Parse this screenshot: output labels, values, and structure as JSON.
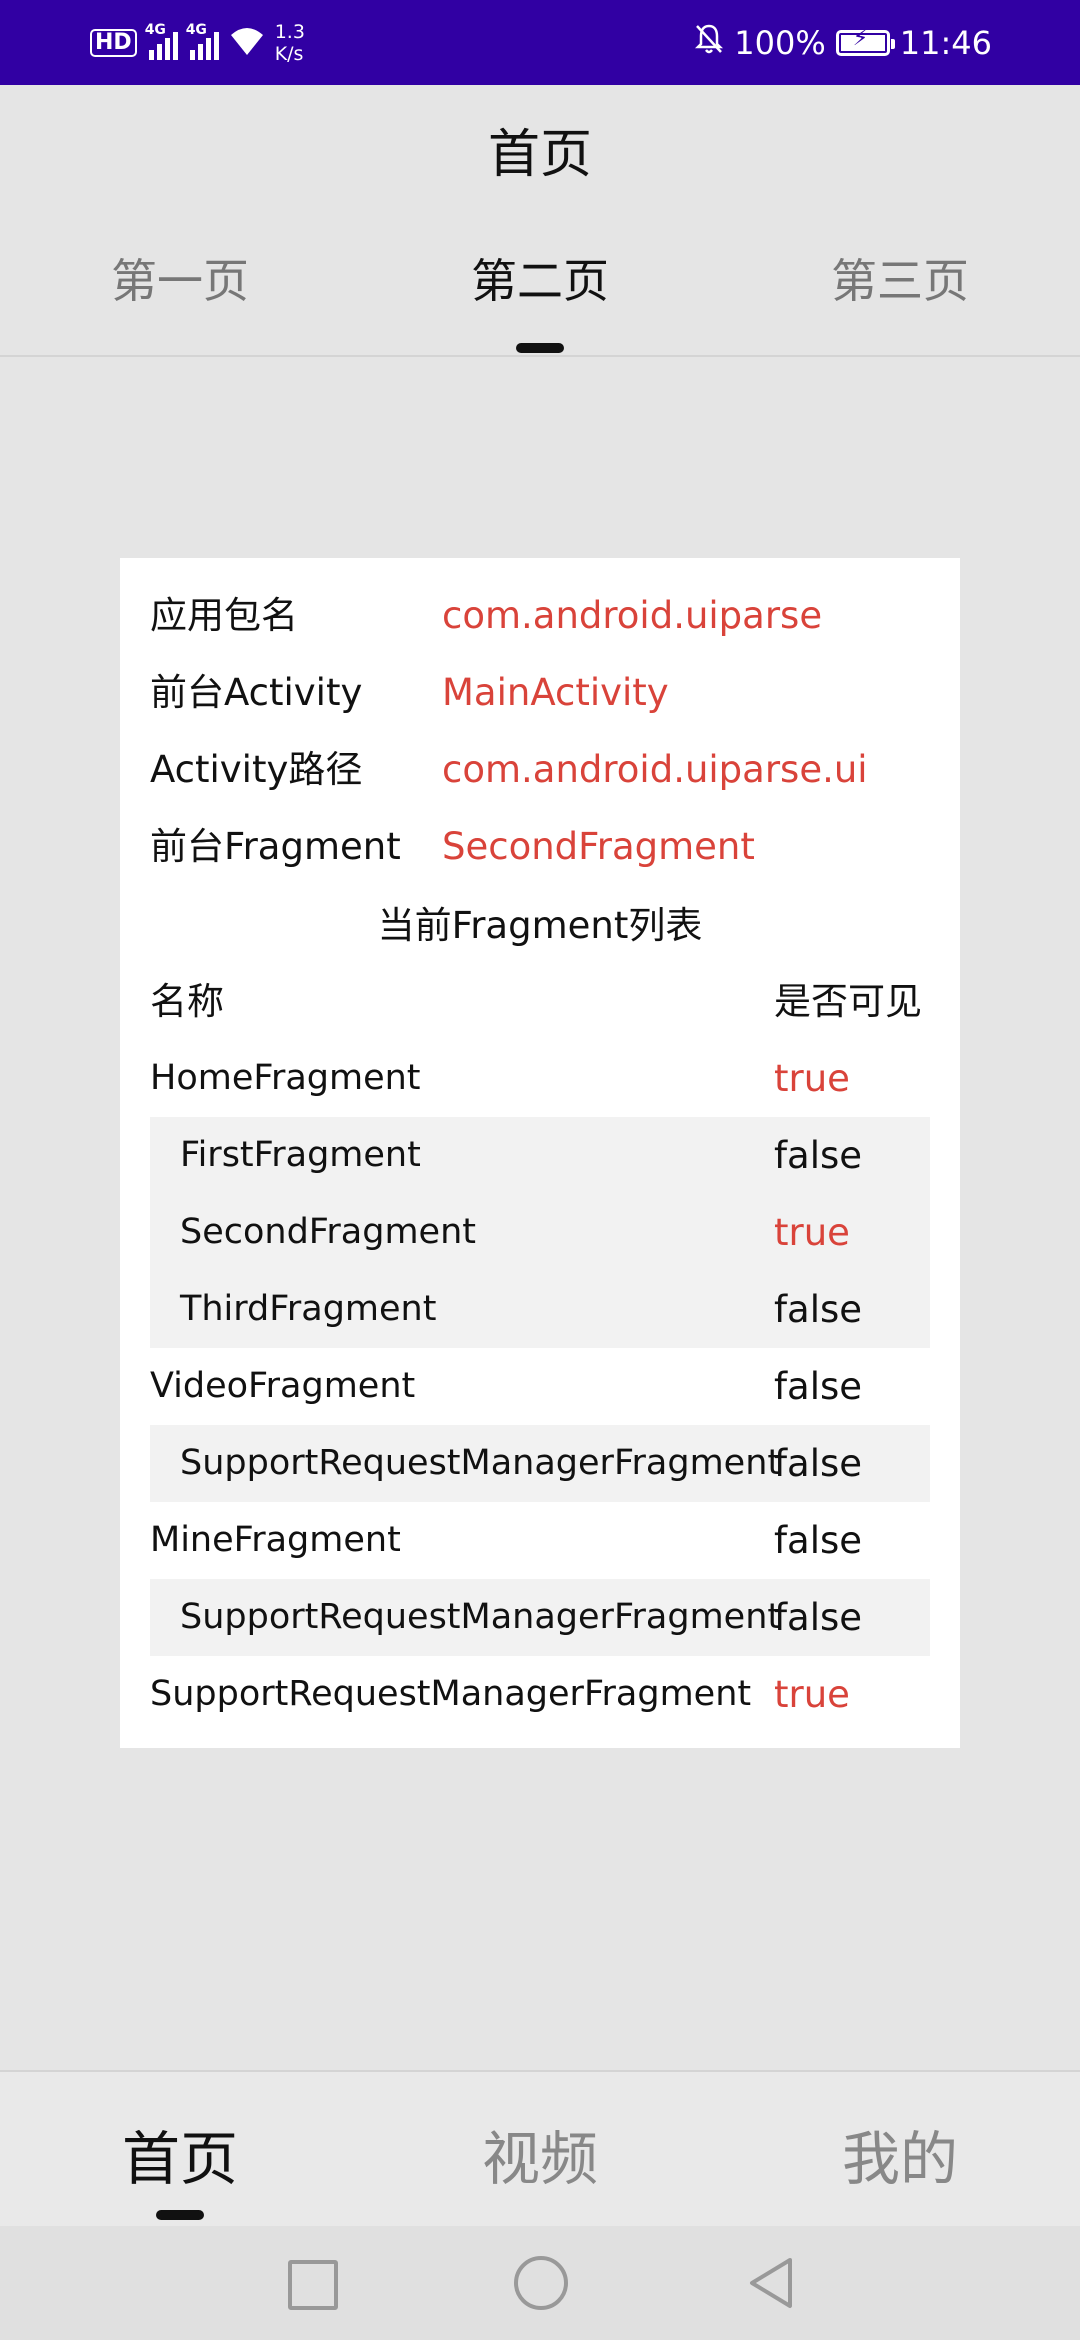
{
  "status_bar": {
    "hd_badge": "HD",
    "sim1_label": "4G",
    "sim2_label": "4G",
    "net_rate_value": "1.3",
    "net_rate_unit": "K/s",
    "battery_percent": "100%",
    "battery_level": 1.0,
    "time": "11:46",
    "icons": [
      "hd-icon",
      "signal-icon",
      "wifi-icon",
      "mute-bell-icon",
      "battery-icon"
    ]
  },
  "appbar": {
    "title": "首页"
  },
  "tabs": [
    {
      "label": "第一页",
      "active": false
    },
    {
      "label": "第二页",
      "active": true
    },
    {
      "label": "第三页",
      "active": false
    }
  ],
  "info": {
    "package_label": "应用包名",
    "package_value": "com.android.uiparse",
    "activity_label": "前台Activity",
    "activity_value": "MainActivity",
    "path_label": "Activity路径",
    "path_value": "com.android.uiparse.ui",
    "fragment_label": "前台Fragment",
    "fragment_value": "SecondFragment"
  },
  "fragment_list": {
    "title": "当前Fragment列表",
    "col_name": "名称",
    "col_visible": "是否可见",
    "rows": [
      {
        "name": "HomeFragment",
        "visible": "true",
        "sub": false
      },
      {
        "name": "FirstFragment",
        "visible": "false",
        "sub": true
      },
      {
        "name": "SecondFragment",
        "visible": "true",
        "sub": true
      },
      {
        "name": "ThirdFragment",
        "visible": "false",
        "sub": true
      },
      {
        "name": "VideoFragment",
        "visible": "false",
        "sub": false
      },
      {
        "name": "SupportRequestManagerFragment",
        "visible": "false",
        "sub": true
      },
      {
        "name": "MineFragment",
        "visible": "false",
        "sub": false
      },
      {
        "name": "SupportRequestManagerFragment",
        "visible": "false",
        "sub": true
      },
      {
        "name": "SupportRequestManagerFragment",
        "visible": "true",
        "sub": false
      }
    ]
  },
  "bottom_nav": [
    {
      "label": "首页",
      "active": true
    },
    {
      "label": "视频",
      "active": false
    },
    {
      "label": "我的",
      "active": false
    }
  ],
  "system_nav": [
    "recents-icon",
    "home-icon",
    "back-icon"
  ],
  "colors": {
    "status_bar": "#3100a3",
    "accent_value": "#d9433a",
    "background": "#e5e5e5"
  }
}
